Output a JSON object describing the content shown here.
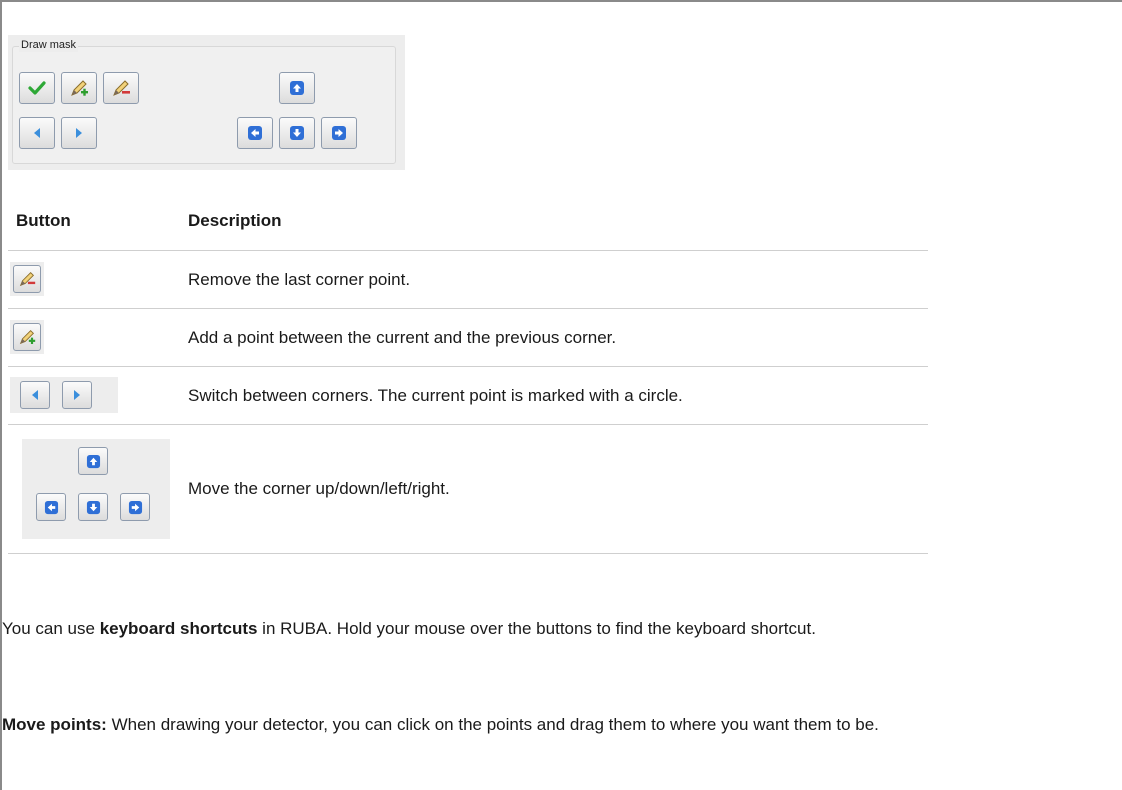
{
  "panel": {
    "legend": "Draw mask"
  },
  "table": {
    "header_button": "Button",
    "header_description": "Description",
    "rows": [
      {
        "description": "Remove the last corner point."
      },
      {
        "description": "Add a point between the current and the previous corner."
      },
      {
        "description": "Switch between corners. The current point is marked with a circle."
      },
      {
        "description": "Move the corner up/down/left/right."
      }
    ]
  },
  "paragraphs": {
    "p1_before": "You can use ",
    "p1_bold": "keyboard shortcuts",
    "p1_after": " in RUBA. Hold your mouse over the buttons to find the keyboard shortcut.",
    "p2_bold": "Move points:",
    "p2_after": " When drawing your detector, you can click on the points and drag them to where you want them to be."
  },
  "icons": {
    "accept": "check-icon",
    "add_point": "pencil-plus-icon",
    "remove_point": "pencil-minus-icon",
    "previous": "triangle-left-icon",
    "next": "triangle-right-icon",
    "up": "arrow-up-icon",
    "down": "arrow-down-icon",
    "left": "arrow-left-icon",
    "right": "arrow-right-icon"
  },
  "colors": {
    "check_green": "#2ea836",
    "pencil_plus_green": "#2e9e2e",
    "pencil_minus_red": "#d23a3a",
    "arrow_blue": "#2f6fd6",
    "triangle_blue": "#3b8fdc"
  }
}
